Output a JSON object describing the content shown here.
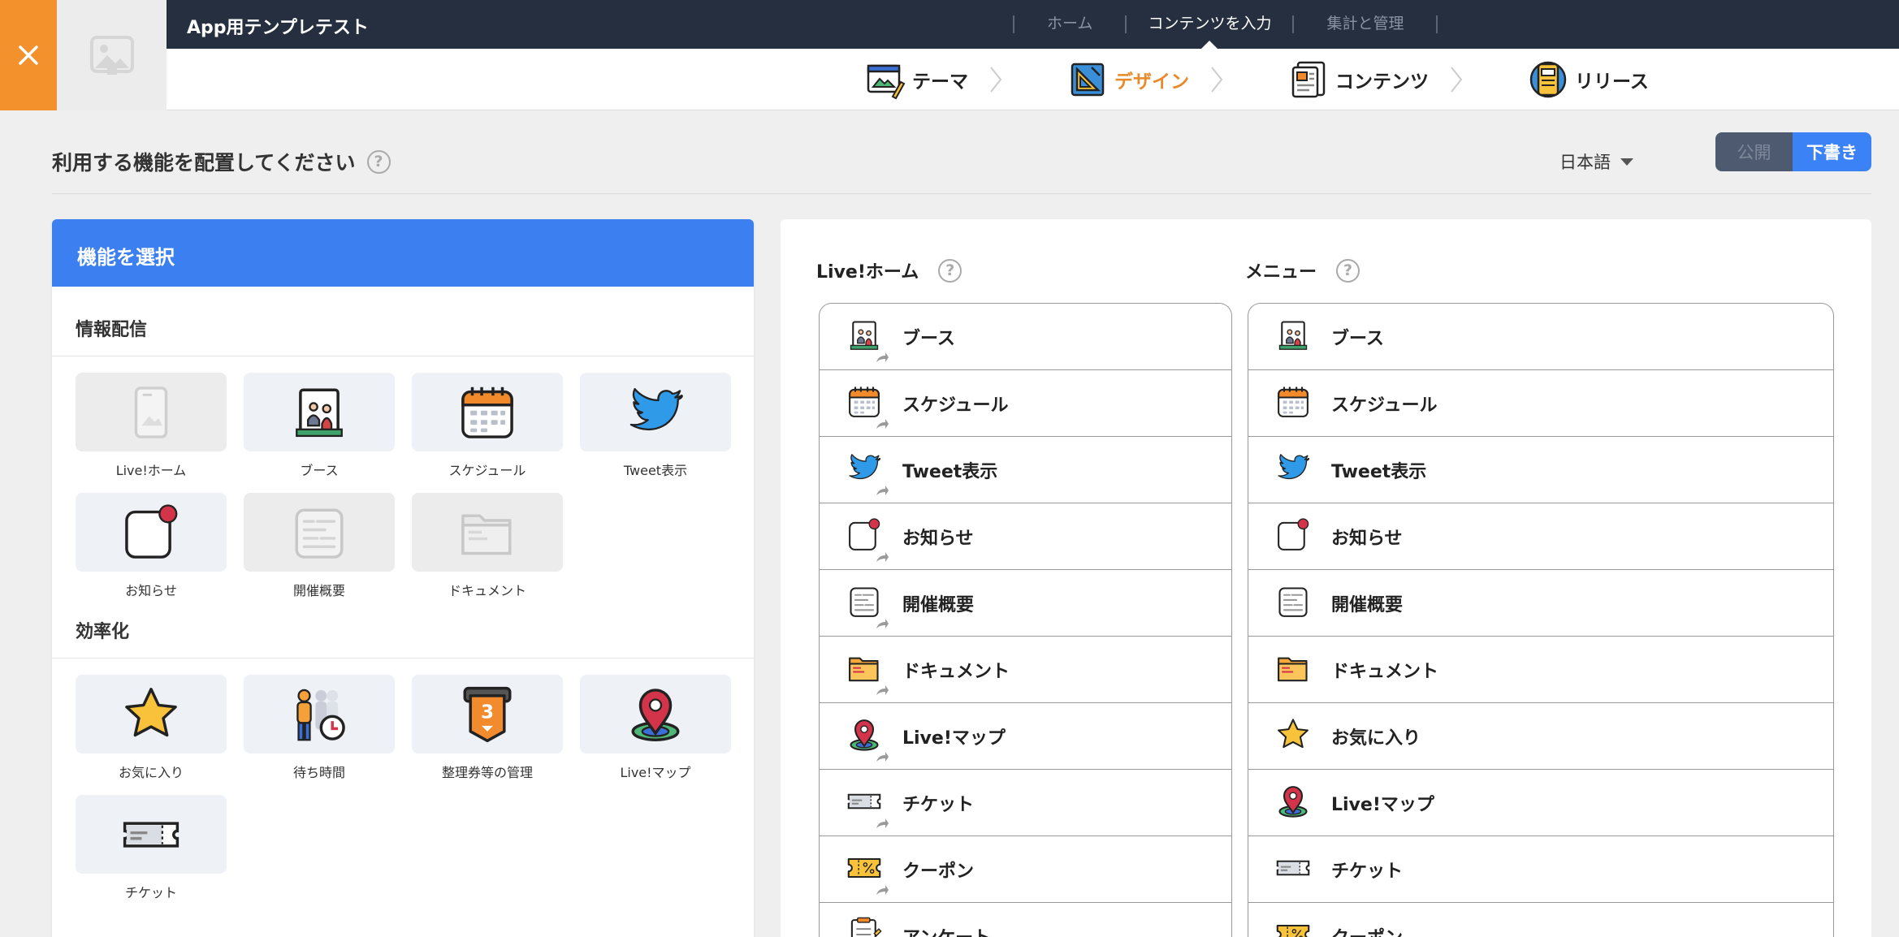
{
  "app": {
    "title": "App用テンプレテスト"
  },
  "topnav": {
    "items": [
      "ホーム",
      "コンテンツを入力",
      "集計と管理"
    ]
  },
  "steps": [
    {
      "label": "テーマ",
      "icon": "theme-icon"
    },
    {
      "label": "デザイン",
      "icon": "design-icon"
    },
    {
      "label": "コンテンツ",
      "icon": "content-icon"
    },
    {
      "label": "リリース",
      "icon": "release-icon"
    }
  ],
  "page": {
    "title": "利用する機能を配置してください",
    "help": "?"
  },
  "lang": {
    "selected": "日本語"
  },
  "publish": {
    "public_label": "公開",
    "draft_label": "下書き"
  },
  "picker": {
    "title": "機能を選択",
    "sections": [
      {
        "title": "情報配信",
        "items": [
          "Live!ホーム",
          "ブース",
          "スケジュール",
          "Tweet表示",
          "お知らせ",
          "開催概要",
          "ドキュメント"
        ]
      },
      {
        "title": "効率化",
        "items": [
          "お気に入り",
          "待ち時間",
          "整理券等の管理",
          "Live!マップ",
          "チケット"
        ]
      }
    ],
    "ticket_number": "3"
  },
  "home_col": {
    "title": "Live!ホーム",
    "items": [
      "ブース",
      "スケジュール",
      "Tweet表示",
      "お知らせ",
      "開催概要",
      "ドキュメント",
      "Live!マップ",
      "チケット",
      "クーポン",
      "アンケート"
    ]
  },
  "menu_col": {
    "title": "メニュー",
    "items": [
      "ブース",
      "スケジュール",
      "Tweet表示",
      "お知らせ",
      "開催概要",
      "ドキュメント",
      "お気に入り",
      "Live!マップ",
      "チケット",
      "クーポン"
    ]
  },
  "colors": {
    "accent": "#3b7ff0",
    "orange": "#f3922d",
    "header": "#262f3f"
  }
}
